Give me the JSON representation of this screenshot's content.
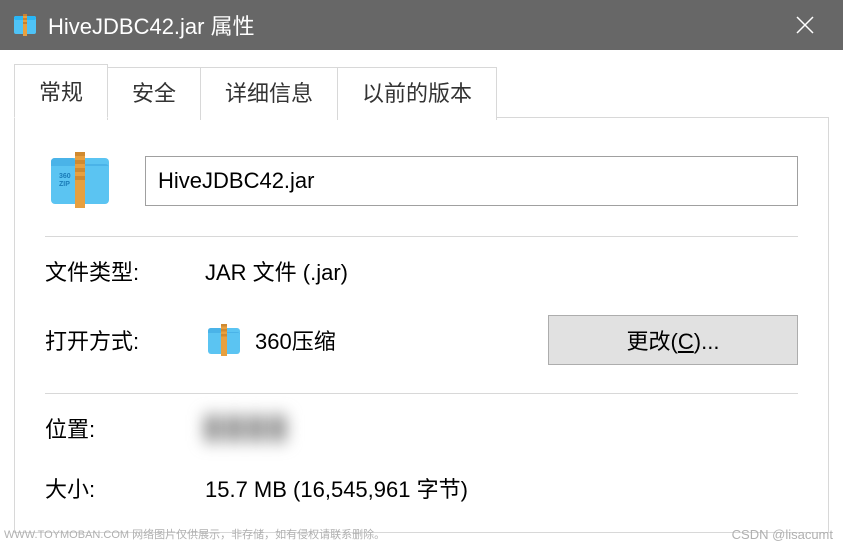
{
  "titlebar": {
    "title": "HiveJDBC42.jar 属性"
  },
  "tabs": [
    {
      "label": "常规",
      "active": true
    },
    {
      "label": "安全",
      "active": false
    },
    {
      "label": "详细信息",
      "active": false
    },
    {
      "label": "以前的版本",
      "active": false
    }
  ],
  "filename": "HiveJDBC42.jar",
  "properties": {
    "file_type_label": "文件类型:",
    "file_type_value": "JAR 文件 (.jar)",
    "open_with_label": "打开方式:",
    "open_with_value": "360压缩",
    "change_button_text": "更改(C)...",
    "location_label": "位置:",
    "location_value": "████",
    "size_label": "大小:",
    "size_value": "15.7 MB (16,545,961 字节)"
  },
  "watermark_left": "WWW.TOYMOBAN.COM 网络图片仅供展示，非存储，如有侵权请联系删除。",
  "watermark_right": "CSDN @lisacumt",
  "icons": {
    "zip_label": "360ZIP"
  }
}
